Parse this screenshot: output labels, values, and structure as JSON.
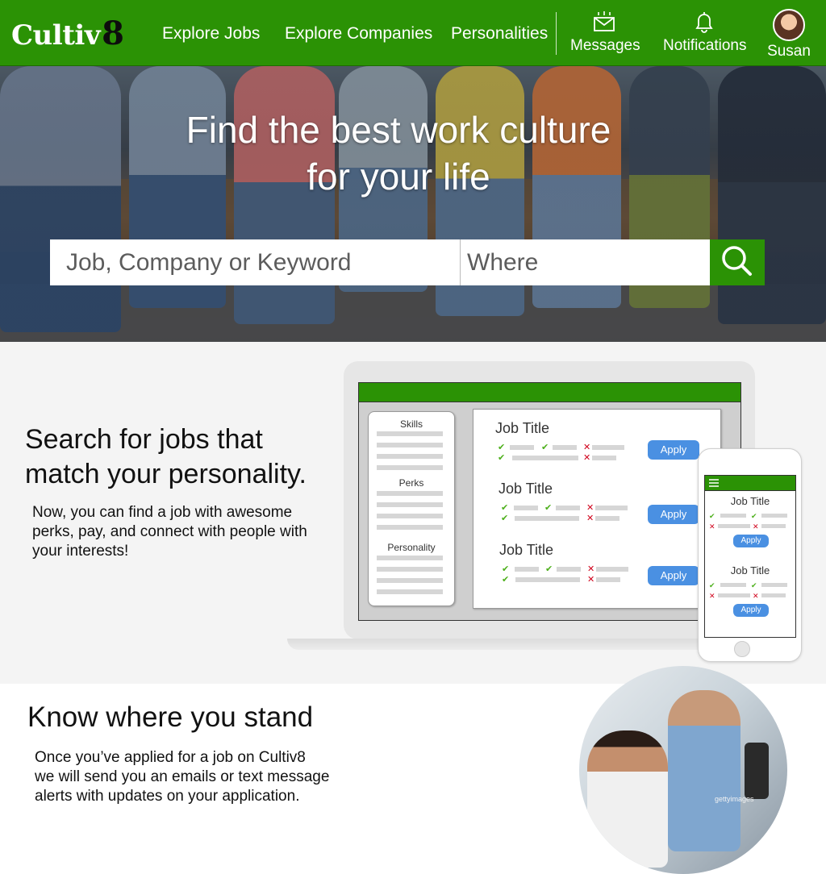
{
  "nav": {
    "logo_text": "Cultiv",
    "logo_number": "8",
    "links": [
      "Explore Jobs",
      "Explore Companies",
      "Personalities"
    ],
    "messages_label": "Messages",
    "notifications_label": "Notifications",
    "user_label": "Susan",
    "icons": {
      "messages": "envelope-icon",
      "notifications": "bell-icon",
      "user": "avatar"
    },
    "brand_color": "#2b9205"
  },
  "hero": {
    "title_line1": "Find the best work culture",
    "title_line2": "for your life",
    "search_placeholder": "Job, Company or Keyword",
    "where_placeholder": "Where",
    "search_icon": "search-icon"
  },
  "section_search": {
    "title_line1": "Search for jobs that",
    "title_line2": "match your personality.",
    "body": "Now, you can find a job with awesome perks, pay, and connect with people with your interests!",
    "mockup": {
      "filters": [
        "Skills",
        "Perks",
        "Personality"
      ],
      "jobs": [
        {
          "title": "Job Title",
          "button": "Apply"
        },
        {
          "title": "Job Title",
          "button": "Apply"
        },
        {
          "title": "Job Title",
          "button": "Apply"
        }
      ],
      "phone_jobs": [
        {
          "title": "Job Title",
          "button": "Apply"
        },
        {
          "title": "Job Title",
          "button": "Apply"
        }
      ],
      "accent": "#4a90e2"
    }
  },
  "section_stand": {
    "title": "Know where you stand",
    "body_line1": "Once you’ve applied for a job on Cultiv8",
    "body_line2": "we will send you an emails or text message",
    "body_line3": "alerts with updates on your application.",
    "watermark": "gettyimages"
  }
}
